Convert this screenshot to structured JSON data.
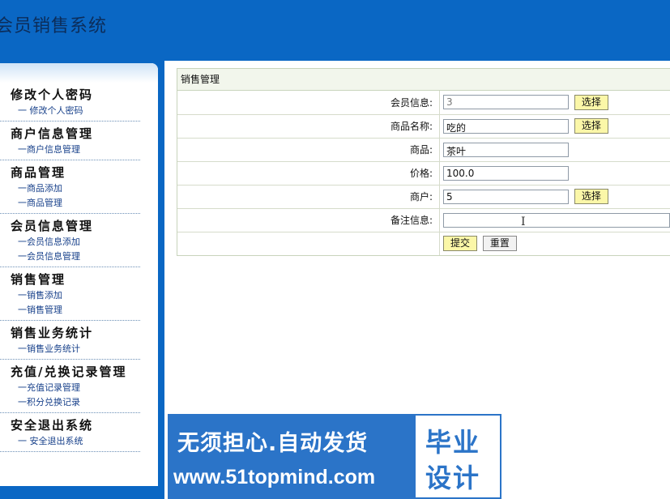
{
  "header": {
    "title": "会员销售系统"
  },
  "sidebar": {
    "groups": [
      {
        "title": "修改个人密码",
        "items": [
          "一  修改个人密码"
        ]
      },
      {
        "title": "商户信息管理",
        "items": [
          "一商户信息管理"
        ]
      },
      {
        "title": "商品管理",
        "items": [
          "一商品添加",
          "一商品管理"
        ]
      },
      {
        "title": "会员信息管理",
        "items": [
          "一会员信息添加",
          "一会员信息管理"
        ]
      },
      {
        "title": "销售管理",
        "items": [
          "一销售添加",
          "一销售管理"
        ]
      },
      {
        "title": "销售业务统计",
        "items": [
          "一销售业务统计"
        ]
      },
      {
        "title": "充值/兑换记录管理",
        "items": [
          "一充值记录管理",
          "一积分兑换记录"
        ]
      },
      {
        "title": "安全退出系统",
        "items": [
          "一  安全退出系统"
        ]
      }
    ]
  },
  "form": {
    "title": "销售管理",
    "member_label": "会员信息:",
    "member_value": "3",
    "product_name_label": "商品名称:",
    "product_name_value": "吃的",
    "product_label": "商品:",
    "product_value": "茶叶",
    "price_label": "价格:",
    "price_value": "100.0",
    "merchant_label": "商户:",
    "merchant_value": "5",
    "remark_label": "备注信息:",
    "remark_value": "",
    "select_label": "选择",
    "submit_label": "提交",
    "reset_label": "重置"
  },
  "watermark": {
    "line1": "无须担心.自动发货",
    "line2": "www.51topmind.com",
    "badge1": "毕业",
    "badge2": "设计"
  },
  "colors": {
    "header_bg": "#0a67c4",
    "button_bg": "#fbf7a8"
  }
}
